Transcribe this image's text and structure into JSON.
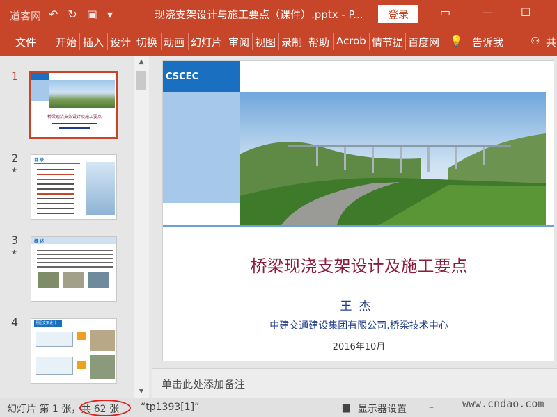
{
  "titlebar": {
    "watermark": "道客网",
    "title": "现浇支架设计与施工要点（课件）.pptx  -  P...",
    "login_label": "登录"
  },
  "ribbon": {
    "tabs": [
      "文件",
      "开始",
      "插入",
      "设计",
      "切换",
      "动画",
      "幻灯片",
      "审阅",
      "视图",
      "录制",
      "帮助",
      "Acrob",
      "情节提",
      "百度网"
    ],
    "tell_me": "告诉我",
    "share": "共"
  },
  "thumbnails": {
    "numbers": [
      "1",
      "2",
      "3",
      "4"
    ],
    "star": "★",
    "t1_title": "桥梁现浇支架设计及施工要点",
    "t2_heading": "目 录",
    "t3_heading": "概 述",
    "t4_heading": "预压支架设计"
  },
  "slide": {
    "logo_text": "CSCEC",
    "title": "桥梁现浇支架设计及施工要点",
    "author": "王杰",
    "org": "中建交通建设集团有限公司.桥梁技术中心",
    "date": "2016年10月"
  },
  "notes": {
    "placeholder": "单击此处添加备注"
  },
  "statusbar": {
    "slide_info": "幻灯片 第 1 张，共 62 张",
    "file_label": "“tp1393[1]”",
    "display_settings": "显示器设置",
    "watermark": "www.cndao.com"
  },
  "colors": {
    "accent": "#c7462a",
    "slide_blue": "#1a6fc0",
    "title_red": "#8b1c3a",
    "text_blue": "#1f3e8a"
  }
}
